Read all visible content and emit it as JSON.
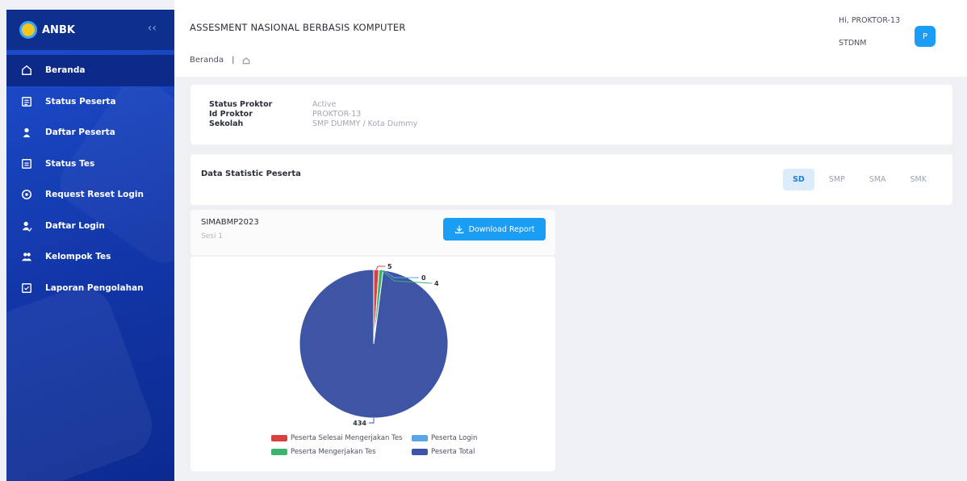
{
  "sidebar": {
    "brand": "ANBK",
    "collapse_icon": "chevron-left-icon",
    "items": [
      {
        "label": "Beranda",
        "icon": "home-icon",
        "active": true
      },
      {
        "label": "Status Peserta",
        "icon": "clipboard-icon"
      },
      {
        "label": "Daftar Peserta",
        "icon": "user-icon"
      },
      {
        "label": "Status Tes",
        "icon": "list-icon"
      },
      {
        "label": "Request Reset Login",
        "icon": "reset-icon"
      },
      {
        "label": "Daftar Login",
        "icon": "user-check-icon"
      },
      {
        "label": "Kelompok Tes",
        "icon": "group-icon"
      },
      {
        "label": "Laporan Pengolahan",
        "icon": "report-icon"
      }
    ]
  },
  "header": {
    "title": "ASSESMENT NASIONAL BERBASIS KOMPUTER",
    "breadcrumb": "Beranda",
    "breadcrumb_sep": "|",
    "greeting": "Hi, PROKTOR-13",
    "school_code": "STDNM",
    "avatar": "P"
  },
  "info": {
    "status_label": "Status Proktor",
    "status_value": "Active",
    "id_label": "Id Proktor",
    "id_value": "PROKTOR-13",
    "school_label": "Sekolah",
    "school_value": "SMP DUMMY / Kota Dummy"
  },
  "stats": {
    "title": "Data Statistic Peserta",
    "tabs": [
      "SD",
      "SMP",
      "SMA",
      "SMK"
    ],
    "active_tab": "SD"
  },
  "session": {
    "name": "SIMABMP2023",
    "sesi": "Sesi 1",
    "download_label": "Download Report"
  },
  "colors": {
    "primary": "#1a9ef5",
    "sidebar": "#1236a8",
    "selesai": "#d9413f",
    "mengerjakan": "#3cb371",
    "login": "#5aa6e6",
    "total": "#3e55a6"
  },
  "chart_data": {
    "type": "pie",
    "series": [
      {
        "name": "Peserta Selesai Mengerjakan Tes",
        "value": 5
      },
      {
        "name": "Peserta Login",
        "value": 0
      },
      {
        "name": "Peserta Mengerjakan Tes",
        "value": 4
      },
      {
        "name": "Peserta Total",
        "value": 434
      }
    ],
    "legend": [
      "Peserta Selesai Mengerjakan Tes",
      "Peserta Login",
      "Peserta Mengerjakan Tes",
      "Peserta Total"
    ],
    "legend_position": "bottom"
  }
}
